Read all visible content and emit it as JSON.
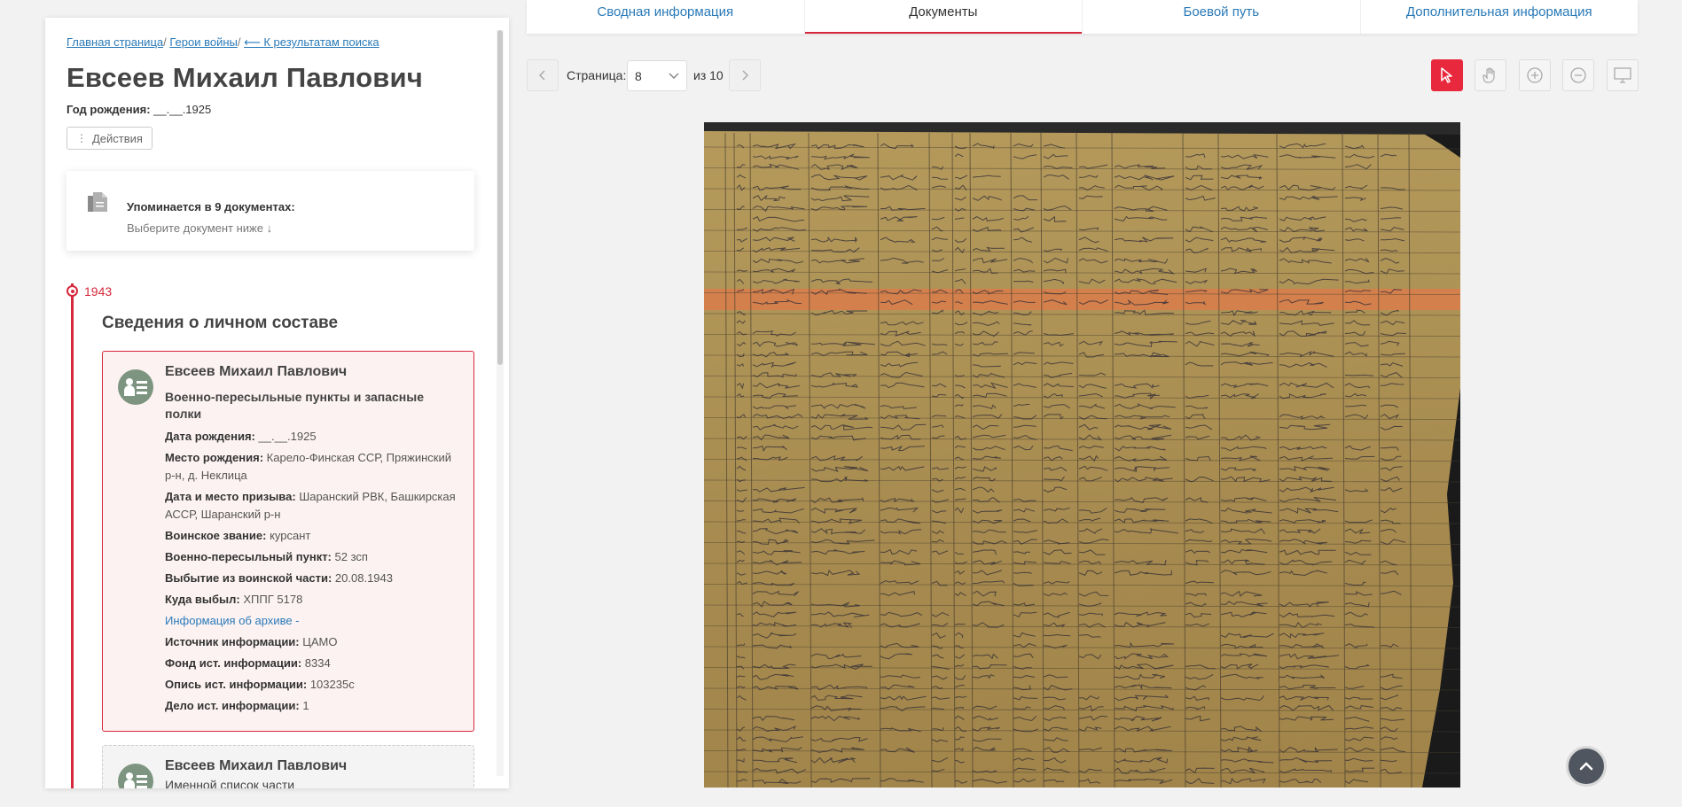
{
  "breadcrumb": {
    "home": "Главная страница",
    "heroes": "Герои войны",
    "back": "⟵ К результатам поиска",
    "sep1": "/ ",
    "sep2": "/ "
  },
  "person": {
    "name": "Евсеев Михаил Павлович",
    "birth_label": "Год рождения:",
    "birth_value": "__.__.1925",
    "actions_label": "Действия"
  },
  "mentions": {
    "title": "Упоминается в 9 документах:",
    "subtitle": "Выберите документ ниже ↓"
  },
  "timeline": {
    "year": "1943",
    "section_title": "Сведения о личном составе"
  },
  "record": {
    "name": "Евсеев Михаил Павлович",
    "subtitle": "Военно-пересыльные пункты и запасные полки",
    "fields": [
      {
        "label": "Дата рождения:",
        "value": "__.__.1925"
      },
      {
        "label": "Место рождения:",
        "value": "Карело-Финская ССР, Пряжинский р-н, д. Неклица"
      },
      {
        "label": "Дата и место призыва:",
        "value": "Шаранский РВК, Башкирская АССР, Шаранский р-н"
      },
      {
        "label": "Воинское звание:",
        "value": "курсант"
      },
      {
        "label": "Военно-пересыльный пункт:",
        "value": "52 зсп"
      },
      {
        "label": "Выбытие из воинской части:",
        "value": "20.08.1943"
      },
      {
        "label": "Куда выбыл:",
        "value": "ХППГ 5178"
      }
    ],
    "archive_link": "Информация об архиве -",
    "archive_fields": [
      {
        "label": "Источник информации:",
        "value": "ЦАМО"
      },
      {
        "label": "Фонд ист. информации:",
        "value": "8334"
      },
      {
        "label": "Опись ист. информации:",
        "value": "103235с"
      },
      {
        "label": "Дело ист. информации:",
        "value": "1"
      }
    ]
  },
  "record2": {
    "name": "Евсеев Михаил Павлович",
    "subtitle": "Именной список части"
  },
  "tabs": [
    {
      "label": "Сводная информация"
    },
    {
      "label": "Документы"
    },
    {
      "label": "Боевой путь"
    },
    {
      "label": "Дополнительная информация"
    }
  ],
  "pager": {
    "label": "Страница:",
    "current": "8",
    "of_text": "из 10"
  },
  "tools": [
    "pointer-icon",
    "hand-icon",
    "zoom-in-icon",
    "zoom-out-icon",
    "fullscreen-icon"
  ],
  "colors": {
    "accent": "#d6283a",
    "link": "#2a7ab8",
    "highlight_row": "#e07a4a"
  }
}
